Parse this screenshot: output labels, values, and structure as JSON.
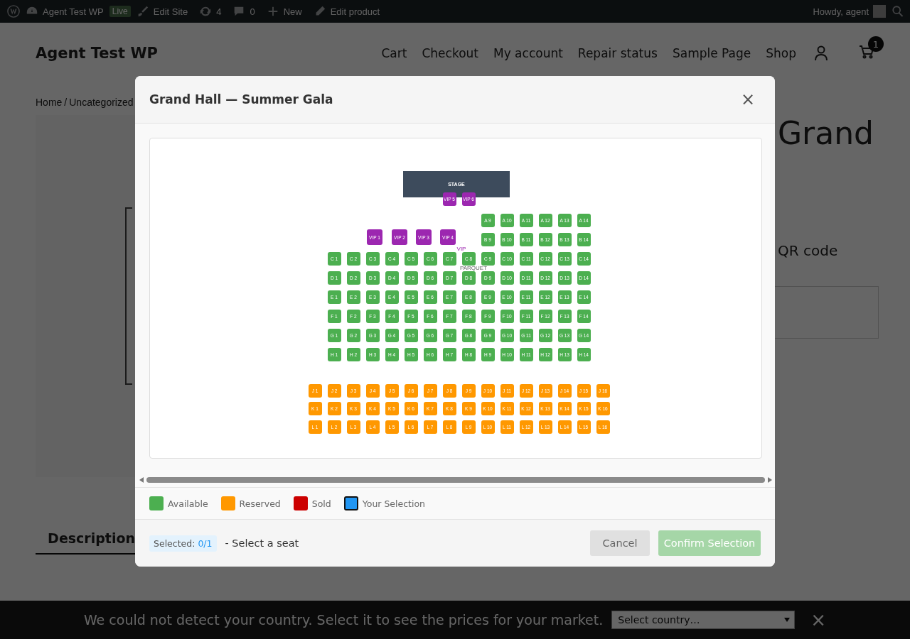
{
  "admin_bar": {
    "site_name": "Agent Test WP",
    "live_badge": "Live",
    "edit_site": "Edit Site",
    "updates": "4",
    "comments": "0",
    "new": "New",
    "edit_product": "Edit product",
    "greeting": "Howdy, agent"
  },
  "site": {
    "title": "Agent Test WP",
    "nav": [
      "Cart",
      "Checkout",
      "My account",
      "Repair status",
      "Sample Page",
      "Shop"
    ],
    "cart_count": "1",
    "breadcrumb": [
      "Home",
      "Uncategorized"
    ],
    "breadcrumb_separator": "/",
    "product_title": "Grand",
    "product_text": "QR code",
    "tab": "Description"
  },
  "modal": {
    "title": "Grand Hall — Summer Gala",
    "close": "×",
    "stage": "STAGE",
    "sections": [
      {
        "kind": "vip",
        "label": "VIP",
        "rows": [
          {
            "seats": [
              "VIP 5",
              "VIP 6"
            ]
          },
          {
            "seats": [
              "VIP 1",
              "VIP 2",
              "VIP 3",
              "VIP 4"
            ]
          }
        ]
      },
      {
        "kind": "parquet",
        "label": "PARQUET",
        "rows": [
          {
            "reserved": false,
            "seats": [
              "A 9",
              "A 10",
              "A 11",
              "A 12",
              "A 13",
              "A 14"
            ]
          },
          {
            "reserved": false,
            "seats": [
              "B 9",
              "B 10",
              "B 11",
              "B 12",
              "B 13",
              "B 14"
            ]
          },
          {
            "reserved": false,
            "seats": [
              "C 1",
              "C 2",
              "C 3",
              "C 4",
              "C 5",
              "C 6",
              "C 7",
              "C 8",
              "C 9",
              "C 10",
              "C 11",
              "C 12",
              "C 13",
              "C 14"
            ]
          },
          {
            "reserved": false,
            "seats": [
              "D 1",
              "D 2",
              "D 3",
              "D 4",
              "D 5",
              "D 6",
              "D 7",
              "D 8",
              "D 9",
              "D 10",
              "D 11",
              "D 12",
              "D 13",
              "D 14"
            ]
          },
          {
            "reserved": false,
            "seats": [
              "E 1",
              "E 2",
              "E 3",
              "E 4",
              "E 5",
              "E 6",
              "E 7",
              "E 8",
              "E 9",
              "E 10",
              "E 11",
              "E 12",
              "E 13",
              "E 14"
            ]
          },
          {
            "reserved": false,
            "seats": [
              "F 1",
              "F 2",
              "F 3",
              "F 4",
              "F 5",
              "F 6",
              "F 7",
              "F 8",
              "F 9",
              "F 10",
              "F 11",
              "F 12",
              "F 13",
              "F 14"
            ]
          },
          {
            "reserved": false,
            "seats": [
              "G 1",
              "G 2",
              "G 3",
              "G 4",
              "G 5",
              "G 6",
              "G 7",
              "G 8",
              "G 9",
              "G 10",
              "G 11",
              "G 12",
              "G 13",
              "G 14"
            ]
          },
          {
            "reserved": false,
            "seats": [
              "H 1",
              "H 2",
              "H 3",
              "H 4",
              "H 5",
              "H 6",
              "H 7",
              "H 8",
              "H 9",
              "H 10",
              "H 11",
              "H 12",
              "H 13",
              "H 14"
            ]
          }
        ]
      },
      {
        "kind": "balcony",
        "rows": [
          {
            "reserved": true,
            "seats": [
              "J 1",
              "J 2",
              "J 3",
              "J 4",
              "J 5",
              "J 6",
              "J 7",
              "J 8",
              "J 9",
              "J 10",
              "J 11",
              "J 12",
              "J 13",
              "J 14",
              "J 15",
              "J 16"
            ]
          },
          {
            "reserved": true,
            "seats": [
              "K 1",
              "K 2",
              "K 3",
              "K 4",
              "K 5",
              "K 6",
              "K 7",
              "K 8",
              "K 9",
              "K 10",
              "K 11",
              "K 12",
              "K 13",
              "K 14",
              "K 15",
              "K 16"
            ]
          },
          {
            "reserved": true,
            "seats": [
              "L 1",
              "L 2",
              "L 3",
              "L 4",
              "L 5",
              "L 6",
              "L 7",
              "L 8",
              "L 9",
              "L 10",
              "L 11",
              "L 12",
              "L 13",
              "L 14",
              "L 15",
              "L 16"
            ]
          }
        ]
      }
    ],
    "legend": [
      {
        "label": "Available",
        "color": "#4caf50",
        "outlined": false
      },
      {
        "label": "Reserved",
        "color": "#ff9800",
        "outlined": false
      },
      {
        "label": "Sold",
        "color": "#cc0000",
        "outlined": false
      },
      {
        "label": "Your Selection",
        "color": "#2196f3",
        "outlined": true
      }
    ],
    "selected_label": "Selected:",
    "selected_count": "0/1",
    "hint": "- Select a seat",
    "buttons": [
      {
        "label": "Cancel",
        "kind": "secondary",
        "disabled": false
      },
      {
        "label": "Confirm Selection",
        "kind": "primary",
        "disabled": true
      }
    ]
  },
  "country_bar": {
    "message": "We could not detect your country. Select it to see the prices for your market.",
    "select_placeholder": "Select country…",
    "close": "×"
  }
}
